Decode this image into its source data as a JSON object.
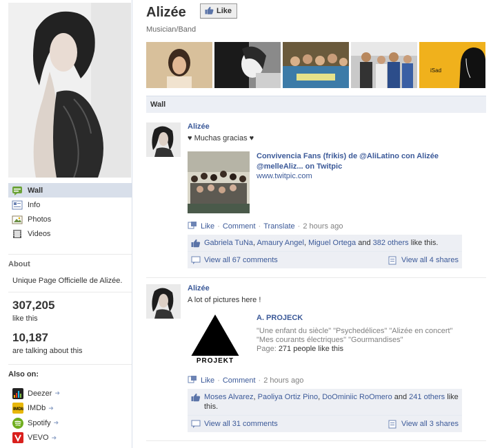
{
  "page": {
    "name": "Alizée",
    "like_label": "Like",
    "category": "Musician/Band"
  },
  "sidebar": {
    "nav": [
      {
        "label": "Wall",
        "icon": "wall-icon"
      },
      {
        "label": "Info",
        "icon": "info-icon"
      },
      {
        "label": "Photos",
        "icon": "photos-icon"
      },
      {
        "label": "Videos",
        "icon": "videos-icon"
      }
    ],
    "about_heading": "About",
    "about_text": "Unique Page Officielle de Alizée.",
    "likes_count": "307,205",
    "likes_label": "like this",
    "talking_count": "10,187",
    "talking_label": "are talking about this",
    "also_on_heading": "Also on:",
    "also_on": [
      {
        "label": "Deezer",
        "icon": "deezer-icon",
        "color": "#222222"
      },
      {
        "label": "IMDb",
        "icon": "imdb-icon",
        "color": "#e8b708"
      },
      {
        "label": "Spotify",
        "icon": "spotify-icon",
        "color": "#6fae1e"
      },
      {
        "label": "VEVO",
        "icon": "vevo-icon",
        "color": "#d9201d"
      }
    ]
  },
  "photo_strip_badge": "iSad",
  "wall_tab": "Wall",
  "posts": [
    {
      "author": "Alizée",
      "message": "♥ Muchas gracias ♥",
      "attachment": {
        "title_line1": "Convivencia Fans (frikis) de @AliLatino con Alizée",
        "title_line2": "@melleAliz... on Twitpic",
        "source": "www.twitpic.com"
      },
      "actions": {
        "like": "Like",
        "comment": "Comment",
        "translate": "Translate",
        "time": "2 hours ago"
      },
      "likes": {
        "names": [
          "Gabriela TuNa",
          "Amaury Angel",
          "Miguel Ortega"
        ],
        "and": "and",
        "others": "382 others",
        "suffix": "like this."
      },
      "view_comments": "View all 67 comments",
      "view_shares": "View all 4 shares"
    },
    {
      "author": "Alizée",
      "message": "A lot of pictures here !",
      "attachment": {
        "title": "A. PROJECK",
        "desc_line1": "\"Une enfant du siècle\" \"Psychedélices\" \"Alizée en concert\"",
        "desc_line2": "\"Mes courants électriques\" \"Gourmandises\"",
        "page_label": "Page:",
        "page_count": "271 people like this",
        "logo_text": "PROJEKT"
      },
      "actions": {
        "like": "Like",
        "comment": "Comment",
        "time": "2 hours ago"
      },
      "likes": {
        "names": [
          "Moses Alvarez",
          "Paoliya Ortiz Pino",
          "DoOminiic RoOmero"
        ],
        "and": "and",
        "others": "241 others",
        "suffix": "like",
        "suffix2": "this."
      },
      "view_comments": "View all 31 comments",
      "view_shares": "View all 3 shares"
    }
  ],
  "colors": {
    "link": "#3b5998",
    "nav_active": "#d8dfea",
    "ufi_bg": "#edeff4"
  }
}
